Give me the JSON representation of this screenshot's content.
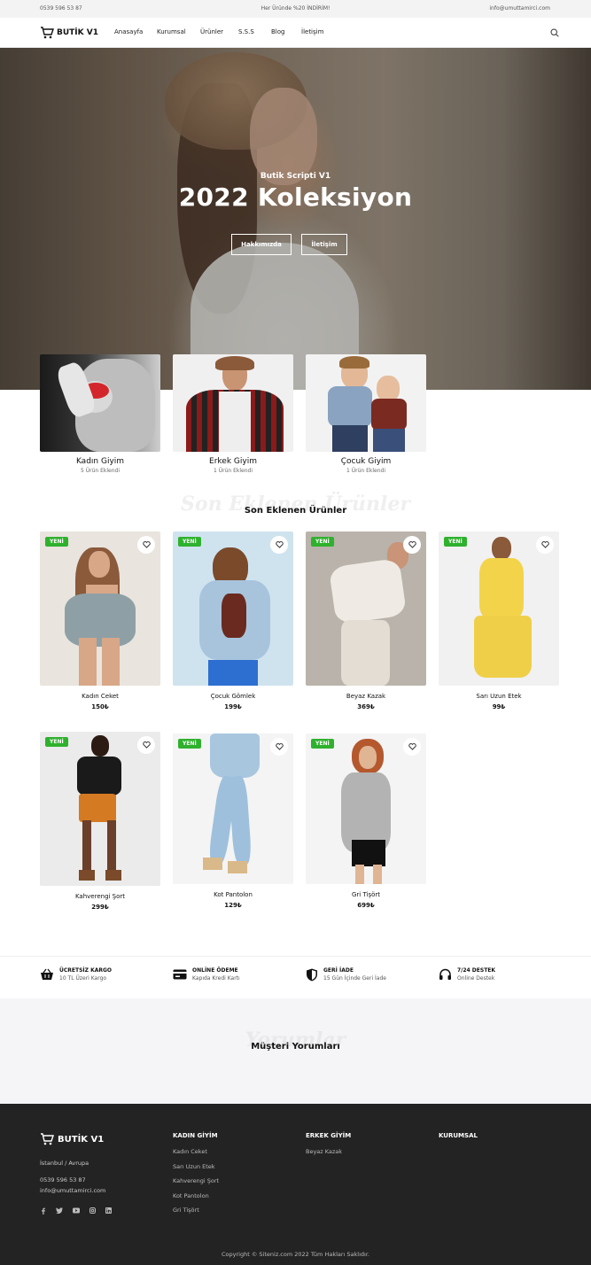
{
  "topbar": {
    "phone": "0539 596 53 87",
    "promo": "Her Üründe %20 İNDİRİM!",
    "email": "info@umuttamirci.com"
  },
  "header": {
    "logo": "BUTİK V1",
    "nav": [
      "Anasayfa",
      "Kurumsal",
      "Ürünler",
      "S.S.S",
      "Blog",
      "İletişim"
    ],
    "search_icon": "search-icon"
  },
  "hero": {
    "subtitle": "Butik Scripti V1",
    "title": "2022 Koleksiyon",
    "buttons": [
      "Hakkımızda",
      "İletişim"
    ]
  },
  "categories": [
    {
      "title": "Kadın Giyim",
      "count": "5 Ürün Eklendi"
    },
    {
      "title": "Erkek Giyim",
      "count": "1 Ürün Eklendi"
    },
    {
      "title": "Çocuk Giyim",
      "count": "1 Ürün Eklendi"
    }
  ],
  "latest": {
    "ghost": "Son Eklenen Ürünler",
    "title": "Son Eklenen Ürünler",
    "badge": "YENİ",
    "products": [
      {
        "name": "Kadın Ceket",
        "price": "150₺"
      },
      {
        "name": "Çocuk Gömlek",
        "price": "199₺"
      },
      {
        "name": "Beyaz Kazak",
        "price": "369₺"
      },
      {
        "name": "Sarı Uzun Etek",
        "price": "99₺"
      },
      {
        "name": "Kahverengi Şort",
        "price": "299₺"
      },
      {
        "name": "Kot Pantolon",
        "price": "129₺"
      },
      {
        "name": "Gri Tişört",
        "price": "699₺"
      }
    ]
  },
  "features": [
    {
      "title": "ÜCRETSİZ KARGO",
      "sub": "10 TL Üzeri Kargo",
      "icon": "basket-icon"
    },
    {
      "title": "ONLİNE ÖDEME",
      "sub": "Kapıda Kredi Kartı",
      "icon": "credit-card-icon"
    },
    {
      "title": "GERİ İADE",
      "sub": "15 Gün İçinde Geri İade",
      "icon": "shield-icon"
    },
    {
      "title": "7/24 DESTEK",
      "sub": "Online Destek",
      "icon": "headset-icon"
    }
  ],
  "reviews": {
    "ghost": "Yorumlar",
    "title": "Müşteri Yorumları"
  },
  "footer": {
    "logo": "BUTİK V1",
    "address": "İstanbul / Avrupa",
    "phone": "0539 596 53 87",
    "email": "info@umuttamirci.com",
    "social": [
      "facebook-icon",
      "twitter-icon",
      "youtube-icon",
      "instagram-icon",
      "linkedin-icon"
    ],
    "columns": [
      {
        "title": "KADIN GİYİM",
        "links": [
          "Kadın Ceket",
          "Sarı Uzun Etek",
          "Kahverengi Şort",
          "Kot Pantolon",
          "Gri Tişört"
        ]
      },
      {
        "title": "ERKEK GİYİM",
        "links": [
          "Beyaz Kazak"
        ]
      },
      {
        "title": "KURUMSAL",
        "links": []
      }
    ],
    "copyright": "Copyright © Siteniz.com 2022 Tüm Hakları Saklıdır."
  },
  "colors": {
    "badge": "#2fb12e",
    "footer_bg": "#232323",
    "accent_red": "#d3262c"
  }
}
